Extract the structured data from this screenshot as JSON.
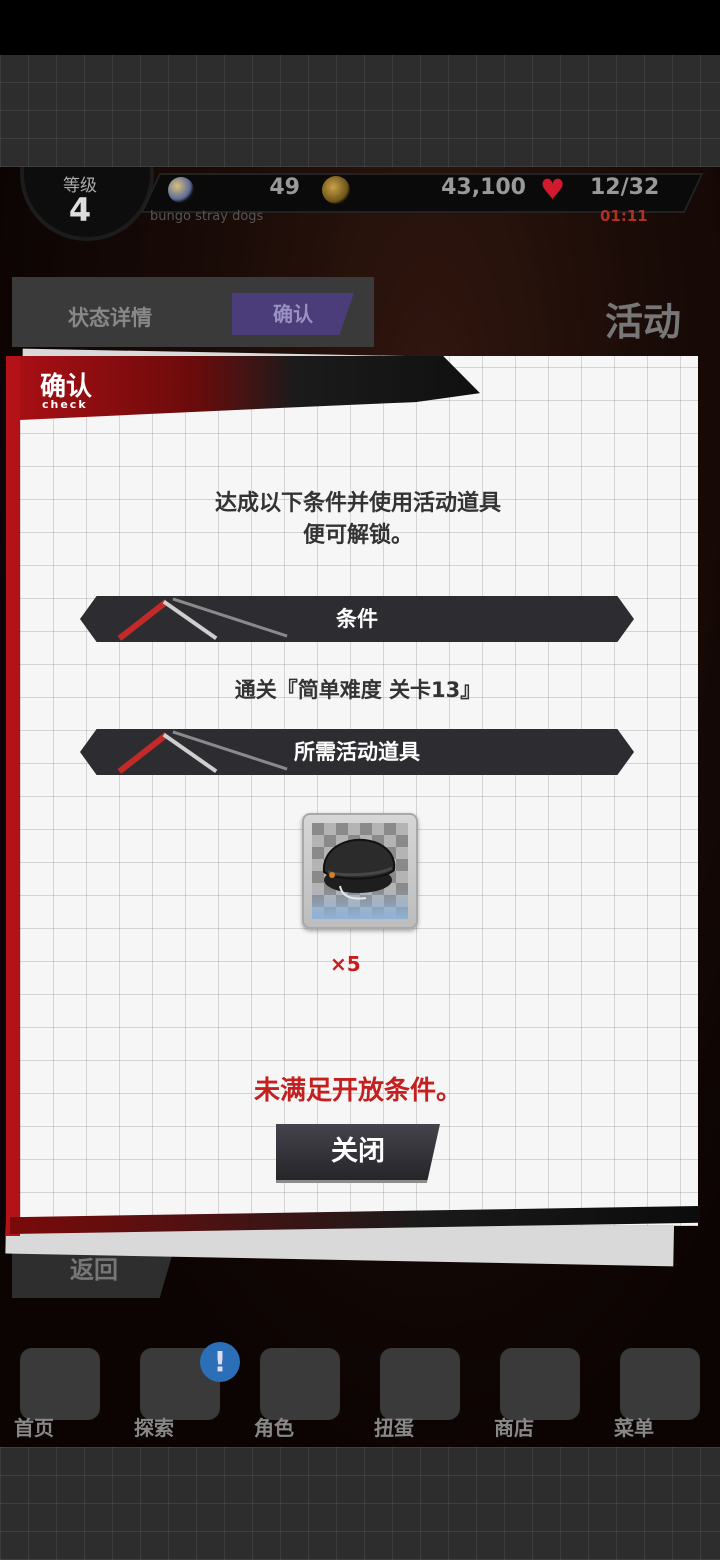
{
  "status_bar": {
    "level_label": "等级",
    "level_value": "4",
    "user_name": "bungo stray dogs",
    "moon_value": "49",
    "coin_value": "43,100",
    "stamina_value": "12/32",
    "stamina_timer": "01:11"
  },
  "background": {
    "status_detail_label": "状态详情",
    "status_confirm_label": "确认",
    "activity_title": "活动",
    "back_label": "返回"
  },
  "nav": {
    "items": [
      {
        "label": "首页",
        "icon": "home-icon"
      },
      {
        "label": "探索",
        "icon": "explore-icon"
      },
      {
        "label": "角色",
        "icon": "characters-icon"
      },
      {
        "label": "扭蛋",
        "icon": "gacha-icon"
      },
      {
        "label": "商店",
        "icon": "shop-icon"
      },
      {
        "label": "菜单",
        "icon": "settings-gear-icon"
      }
    ],
    "alert_symbol": "!"
  },
  "modal": {
    "title": "确认",
    "subtitle": "check",
    "instruction_line1": "达成以下条件并使用活动道具",
    "instruction_line2": "便可解锁。",
    "condition_header": "条件",
    "condition_text": "通关『简单难度 关卡13』",
    "item_header": "所需活动道具",
    "item_count": "×5",
    "warning": "未满足开放条件。",
    "close_label": "关闭"
  },
  "colors": {
    "accent_red": "#b31317",
    "warning_red": "#c42020",
    "ribbon_dark": "#2d2d31",
    "confirm_purple": "#4a3d7a"
  }
}
